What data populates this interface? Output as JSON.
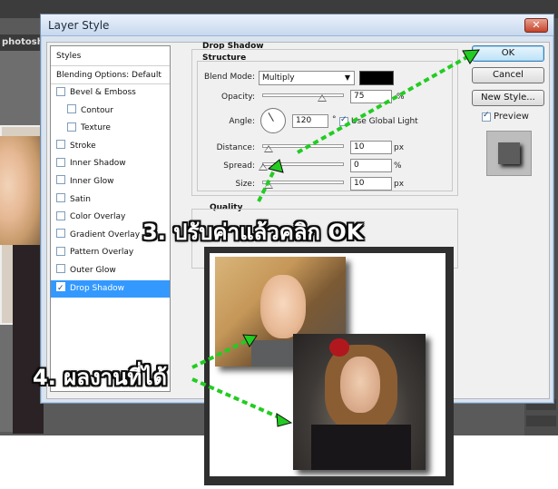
{
  "workspace": {
    "doc_tab_label": "photosho"
  },
  "dialog": {
    "title": "Layer Style",
    "close_label": "✕"
  },
  "styles_list": {
    "header": "Styles",
    "blending_options": "Blending Options: Default",
    "items": [
      {
        "label": "Bevel & Emboss",
        "checked": false
      },
      {
        "label": "Contour",
        "checked": false
      },
      {
        "label": "Texture",
        "checked": false
      },
      {
        "label": "Stroke",
        "checked": false
      },
      {
        "label": "Inner Shadow",
        "checked": false
      },
      {
        "label": "Inner Glow",
        "checked": false
      },
      {
        "label": "Satin",
        "checked": false
      },
      {
        "label": "Color Overlay",
        "checked": false
      },
      {
        "label": "Gradient Overlay",
        "checked": false
      },
      {
        "label": "Pattern Overlay",
        "checked": false
      },
      {
        "label": "Outer Glow",
        "checked": false
      },
      {
        "label": "Drop Shadow",
        "checked": true,
        "selected": true
      }
    ]
  },
  "drop_shadow": {
    "group_title": "Drop Shadow",
    "structure_title": "Structure",
    "blend_mode_label": "Blend Mode:",
    "blend_mode_value": "Multiply",
    "shadow_color": "#000000",
    "opacity_label": "Opacity:",
    "opacity_value": "75",
    "opacity_unit": "%",
    "angle_label": "Angle:",
    "angle_value": "120",
    "angle_unit": "°",
    "use_global_light_label": "Use Global Light",
    "use_global_light": true,
    "distance_label": "Distance:",
    "distance_value": "10",
    "distance_unit": "px",
    "spread_label": "Spread:",
    "spread_value": "0",
    "spread_unit": "%",
    "size_label": "Size:",
    "size_value": "10",
    "size_unit": "px",
    "quality_title": "Quality"
  },
  "buttons": {
    "ok": "OK",
    "cancel": "Cancel",
    "new_style": "New Style...",
    "preview_label": "Preview",
    "preview_checked": true
  },
  "annotations": {
    "step3": "3. ปรับค่าแล้วคลิก OK",
    "step4": "4. ผลงานที่ได้",
    "color": "#22cc22"
  }
}
